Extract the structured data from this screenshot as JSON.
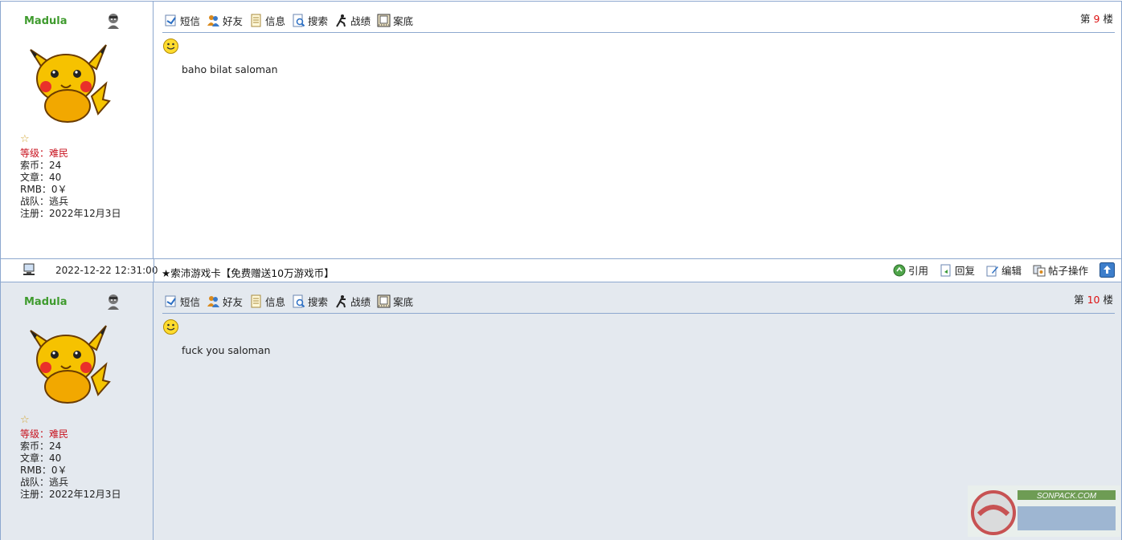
{
  "posts": [
    {
      "username": "Madula",
      "stats": {
        "level_label": "等级：",
        "level_value": "难民",
        "coins": "索币：24",
        "articles": "文章：40",
        "rmb": "RMB：0￥",
        "team": "战队：逃兵",
        "registered": "注册：2022年12月3日"
      },
      "toolbar": {
        "message": "短信",
        "friends": "好友",
        "info": "信息",
        "search": "搜索",
        "record": "战绩",
        "archive": "案底"
      },
      "floor_prefix": "第",
      "floor_number": "9",
      "floor_suffix": "楼",
      "body": "baho bilat saloman"
    },
    {
      "username": "Madula",
      "stats": {
        "level_label": "等级：",
        "level_value": "难民",
        "coins": "索币：24",
        "articles": "文章：40",
        "rmb": "RMB：0￥",
        "team": "战队：逃兵",
        "registered": "注册：2022年12月3日"
      },
      "toolbar": {
        "message": "短信",
        "friends": "好友",
        "info": "信息",
        "search": "搜索",
        "record": "战绩",
        "archive": "案底"
      },
      "floor_prefix": "第",
      "floor_number": "10",
      "floor_suffix": "楼",
      "body": "fuck you saloman"
    }
  ],
  "post_bar": {
    "timestamp": "2022-12-22 12:31:00",
    "ad_text": "★索沛游戏卡【免费赠送10万游戏币】",
    "quote": "引用",
    "reply": "回复",
    "edit": "编辑",
    "manage": "帖子操作"
  },
  "watermark_text": "SONPACK.COM",
  "colors": {
    "border": "#8da8cf",
    "username": "#3f9b2e",
    "level": "#c8121e",
    "floor_number": "#dd1111",
    "alt_row_bg": "#e4e9ef"
  }
}
